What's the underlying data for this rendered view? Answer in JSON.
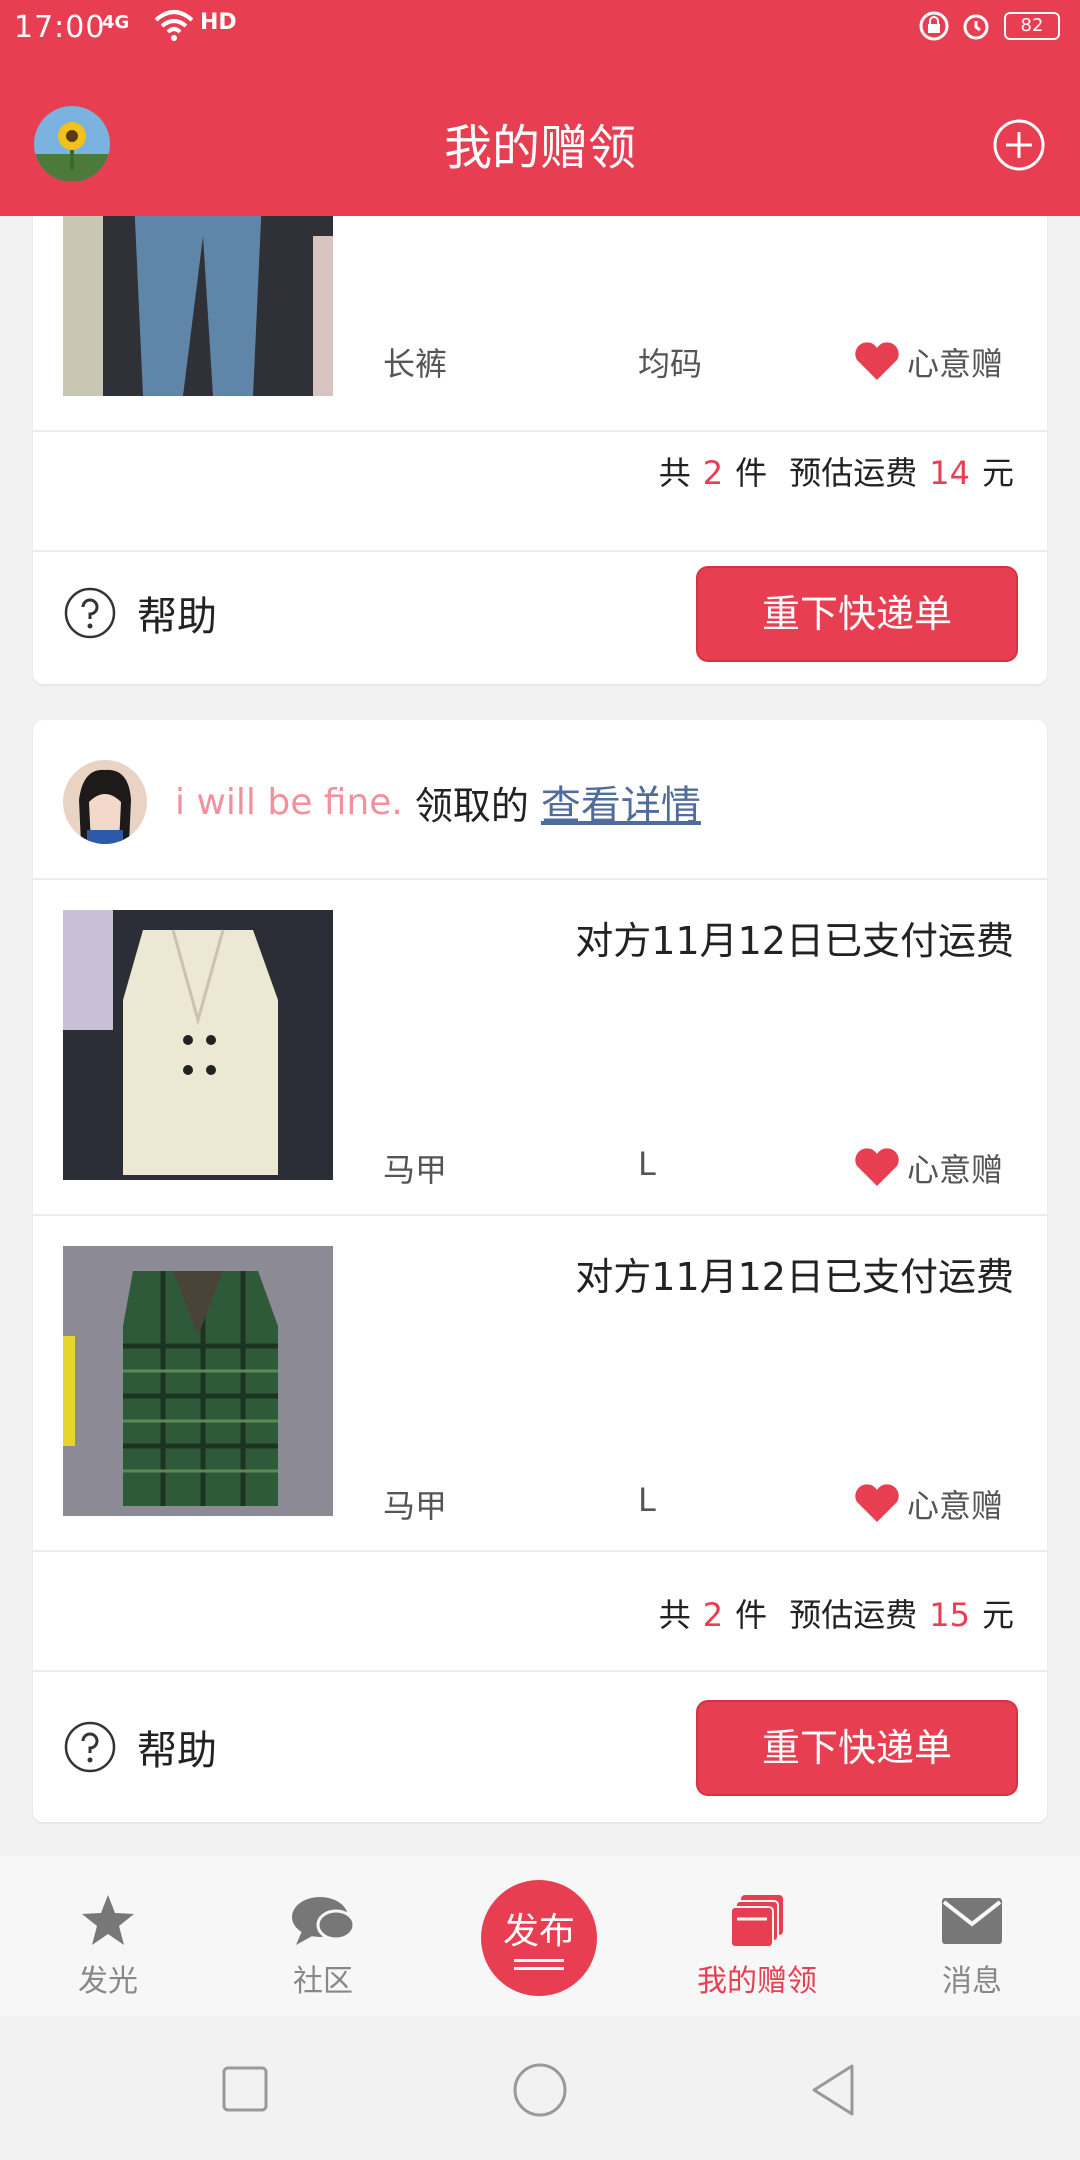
{
  "status_bar": {
    "time": "17:00",
    "signal": "4G",
    "hd": "HD",
    "battery": "82"
  },
  "app_bar": {
    "title": "我的赠领"
  },
  "cards": [
    {
      "items": [
        {
          "name": "长裤",
          "size": "均码",
          "tag": "心意赠"
        }
      ],
      "summary": {
        "prefix": "共",
        "count": "2",
        "count_unit": "件",
        "fee_label": "预估运费",
        "fee": "14",
        "fee_unit": "元"
      },
      "help_label": "帮助",
      "button_label": "重下快递单"
    },
    {
      "claimer": {
        "username": "i will be fine.",
        "action": "领取的",
        "link": "查看详情"
      },
      "items": [
        {
          "note": "对方11月12日已支付运费",
          "name": "马甲",
          "size": "L",
          "tag": "心意赠"
        },
        {
          "note": "对方11月12日已支付运费",
          "name": "马甲",
          "size": "L",
          "tag": "心意赠"
        }
      ],
      "summary": {
        "prefix": "共",
        "count": "2",
        "count_unit": "件",
        "fee_label": "预估运费",
        "fee": "15",
        "fee_unit": "元"
      },
      "help_label": "帮助",
      "button_label": "重下快递单"
    }
  ],
  "tab_bar": {
    "tabs": [
      {
        "label": "发光",
        "icon": "star-icon"
      },
      {
        "label": "社区",
        "icon": "chat-icon"
      },
      {
        "label": "发布",
        "icon": "publish-icon"
      },
      {
        "label": "我的赠领",
        "icon": "cards-icon",
        "active": true
      },
      {
        "label": "消息",
        "icon": "mail-icon"
      }
    ]
  },
  "colors": {
    "primary": "#e83e52",
    "link": "#4f6c9c",
    "username": "#f2909c"
  }
}
